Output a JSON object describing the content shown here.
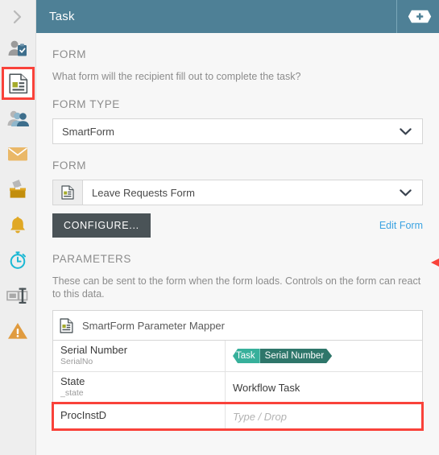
{
  "theme": {
    "header_bg": "#4e8096",
    "accent_link": "#3ba3e2",
    "annotation_red": "#f9423a",
    "token_left": "#37b09b",
    "token_right": "#2e766a",
    "button_dark": "#4a5357"
  },
  "sidebar": {
    "expand_icon": "chevron-right-icon",
    "items": [
      {
        "icon": "person-clipboard-icon",
        "selected": false
      },
      {
        "icon": "document-form-icon",
        "selected": true
      },
      {
        "icon": "people-group-icon",
        "selected": false
      },
      {
        "icon": "envelope-mail-icon",
        "selected": false
      },
      {
        "icon": "ballot-box-icon",
        "selected": false
      },
      {
        "icon": "bell-notification-icon",
        "selected": false
      },
      {
        "icon": "stopwatch-timer-icon",
        "selected": false
      },
      {
        "icon": "text-input-field-icon",
        "selected": false
      },
      {
        "icon": "warning-triangle-icon",
        "selected": false
      }
    ]
  },
  "header": {
    "title": "Task",
    "add_button_icon": "plus-icon"
  },
  "main": {
    "form_section": {
      "label": "FORM",
      "description": "What form will the recipient fill out to complete the task?"
    },
    "form_type": {
      "label": "FORM TYPE",
      "value": "SmartForm",
      "chevron_icon": "chevron-down-icon"
    },
    "form_select": {
      "label": "FORM",
      "value": "Leave Requests Form",
      "leading_icon": "form-document-icon",
      "chevron_icon": "chevron-down-icon"
    },
    "configure_button": "CONFIGURE...",
    "edit_form_link": "Edit Form",
    "parameters_section": {
      "label": "PARAMETERS",
      "description": "These can be sent to the form when the form loads. Controls on the form can react to this data."
    },
    "parameter_mapper": {
      "header_icon": "form-document-icon",
      "header_label": "SmartForm Parameter Mapper",
      "rows": [
        {
          "name": "Serial Number",
          "sub": "SerialNo",
          "value_type": "token",
          "token_scope": "Task",
          "token_field": "Serial Number",
          "highlighted": false
        },
        {
          "name": "State",
          "sub": "_state",
          "value_type": "text",
          "value": "Workflow Task",
          "highlighted": false
        },
        {
          "name": "ProcInstD",
          "sub": "",
          "value_type": "placeholder",
          "placeholder": "Type / Drop",
          "highlighted": true
        }
      ]
    }
  },
  "annotations": {
    "parameters_arrow": "red-left-arrow-annotation",
    "procinstd_box": "red-highlight-box-annotation",
    "sidebar_box": "red-highlight-box-annotation"
  }
}
